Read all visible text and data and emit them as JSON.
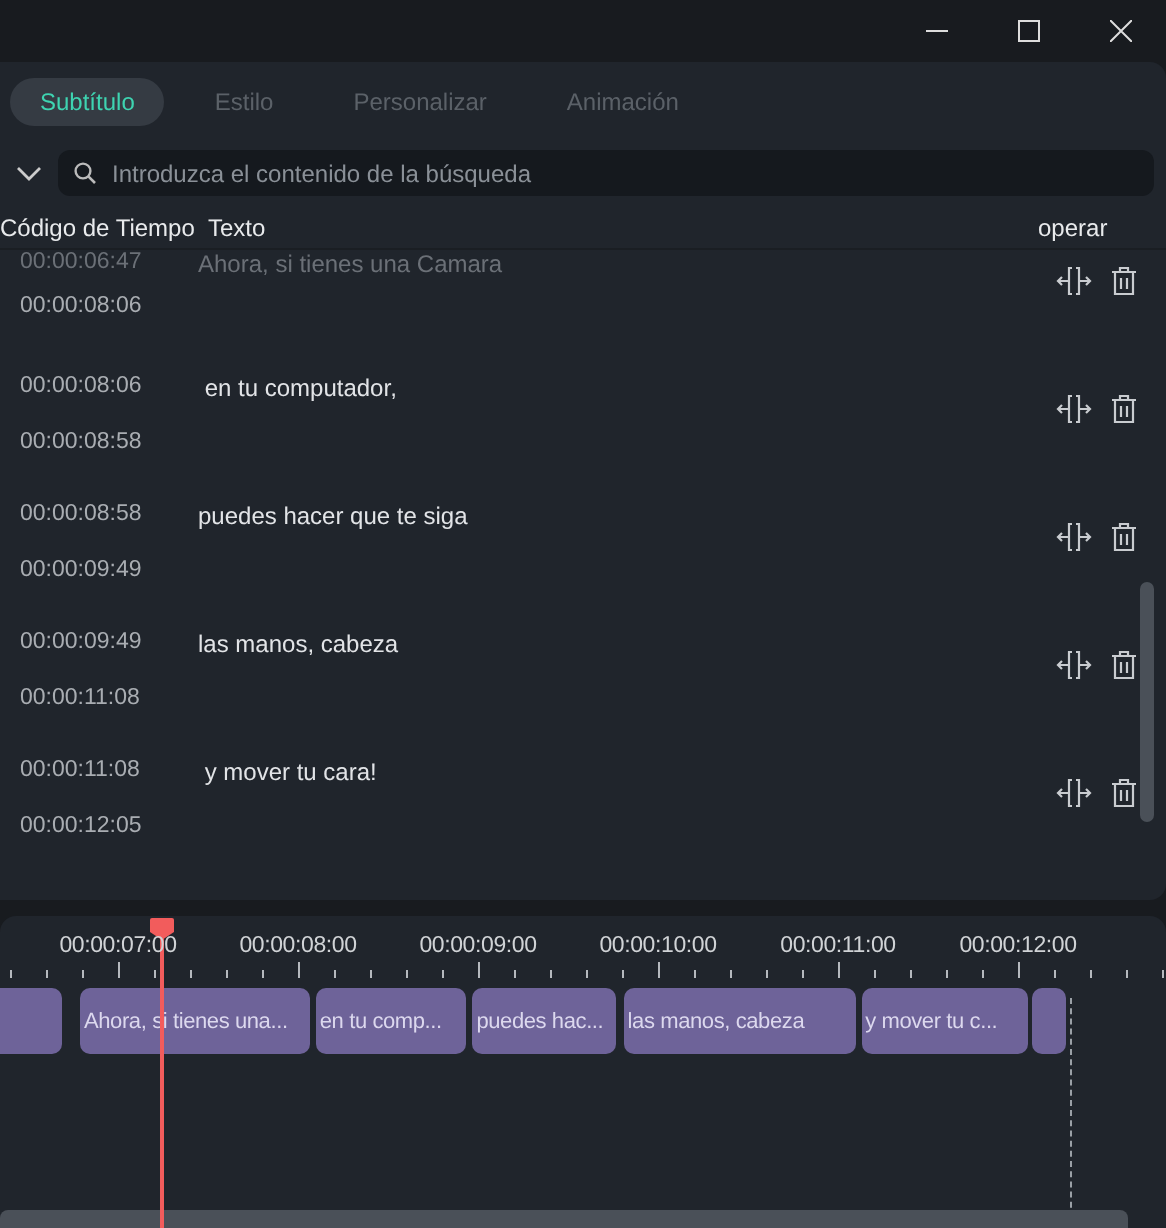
{
  "tabs": [
    {
      "label": "Subtítulo",
      "selected": true
    },
    {
      "label": "Estilo",
      "selected": false
    },
    {
      "label": "Personalizar",
      "selected": false
    },
    {
      "label": "Animación",
      "selected": false
    }
  ],
  "search": {
    "placeholder": "Introduzca el contenido de la búsqueda"
  },
  "table": {
    "columns": [
      "Código de Tiempo",
      "Texto",
      "operar"
    ],
    "rows": [
      {
        "start": "00:00:06:47",
        "end": "00:00:08:06",
        "text": "Ahora, si tienes una Camara",
        "faded": true
      },
      {
        "start": "00:00:08:06",
        "end": "00:00:08:58",
        "text": " en tu computador,",
        "faded": false
      },
      {
        "start": "00:00:08:58",
        "end": "00:00:09:49",
        "text": "puedes hacer que te siga",
        "faded": false
      },
      {
        "start": "00:00:09:49",
        "end": "00:00:11:08",
        "text": "las manos, cabeza",
        "faded": false
      },
      {
        "start": "00:00:11:08",
        "end": "00:00:12:05",
        "text": " y mover tu cara!",
        "faded": false
      }
    ]
  },
  "timeline": {
    "ruler": [
      "00:00:07:00",
      "00:00:08:00",
      "00:00:09:00",
      "00:00:10:00",
      "00:00:11:00",
      "00:00:12:00"
    ],
    "clips": [
      {
        "kind": "blank"
      },
      {
        "kind": "captioned",
        "label": "Ahora, si tienes una..."
      },
      {
        "kind": "captioned",
        "label": "en tu comp..."
      },
      {
        "kind": "captioned",
        "label": "puedes hac..."
      },
      {
        "kind": "captioned",
        "label": "las manos, cabeza"
      },
      {
        "kind": "captioned",
        "label": "y mover tu c..."
      },
      {
        "kind": "blank"
      }
    ]
  }
}
